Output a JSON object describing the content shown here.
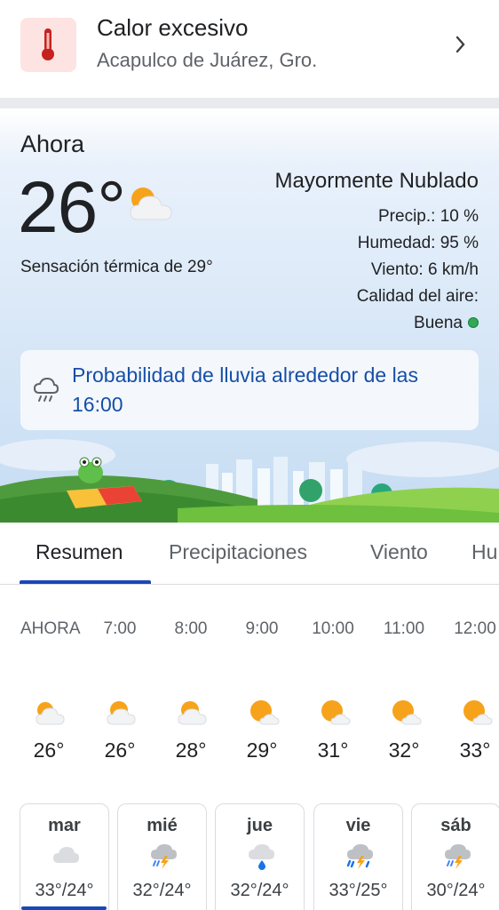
{
  "alert": {
    "title": "Calor excesivo",
    "location": "Acapulco de Juárez, Gro.",
    "icon": "thermometer-icon",
    "icon_color": "#c5221f"
  },
  "current": {
    "label": "Ahora",
    "temperature": "26°",
    "condition": "Mayormente Nublado",
    "feels_like": "Sensación térmica de 29°",
    "precip": "Precip.: 10 %",
    "humidity": "Humedad: 95 %",
    "wind": "Viento: 6 km/h",
    "air_quality_label": "Calidad del aire:",
    "air_quality_value": "Buena",
    "air_quality_color": "#34a853",
    "icon": "partly-cloudy-icon"
  },
  "rain_notice": {
    "text": "Probabilidad de lluvia alrededor de las 16:00",
    "icon": "rain-cloud-icon"
  },
  "tabs": [
    {
      "label": "Resumen",
      "active": true
    },
    {
      "label": "Precipitaciones",
      "active": false
    },
    {
      "label": "Viento",
      "active": false
    },
    {
      "label": "Hu",
      "active": false
    }
  ],
  "hourly": [
    {
      "time": "AHORA",
      "temp": "26°",
      "icon": "partly-cloudy-icon"
    },
    {
      "time": "7:00",
      "temp": "26°",
      "icon": "partly-cloudy-icon"
    },
    {
      "time": "8:00",
      "temp": "28°",
      "icon": "partly-cloudy-icon"
    },
    {
      "time": "9:00",
      "temp": "29°",
      "icon": "mostly-sunny-icon"
    },
    {
      "time": "10:00",
      "temp": "31°",
      "icon": "mostly-sunny-icon"
    },
    {
      "time": "11:00",
      "temp": "32°",
      "icon": "mostly-sunny-icon"
    },
    {
      "time": "12:00",
      "temp": "33°",
      "icon": "mostly-sunny-icon"
    }
  ],
  "daily": [
    {
      "day": "mar",
      "range": "33°/24°",
      "icon": "cloudy-icon",
      "selected": true
    },
    {
      "day": "mié",
      "range": "32°/24°",
      "icon": "thunderstorm-icon",
      "selected": false
    },
    {
      "day": "jue",
      "range": "32°/24°",
      "icon": "rain-icon",
      "selected": false
    },
    {
      "day": "vie",
      "range": "33°/25°",
      "icon": "thunderstorm-rain-icon",
      "selected": false
    },
    {
      "day": "sáb",
      "range": "30°/24°",
      "icon": "thunderstorm-icon",
      "selected": false
    }
  ],
  "colors": {
    "accent": "#1a47b8",
    "rain_text": "#174ea6",
    "alert_bg": "#fde3e1"
  }
}
